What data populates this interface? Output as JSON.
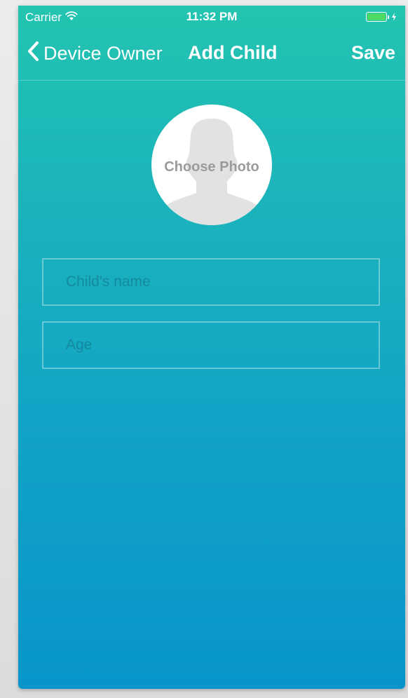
{
  "status_bar": {
    "carrier": "Carrier",
    "wifi_icon": "wifi-icon",
    "time": "11:32 PM",
    "battery_icon": "battery-charging-icon",
    "battery_color": "#4cd964"
  },
  "nav": {
    "back_label": "Device Owner",
    "back_icon": "chevron-left-icon",
    "title": "Add Child",
    "save_label": "Save"
  },
  "photo": {
    "label": "Choose Photo",
    "placeholder_icon": "person-silhouette-icon"
  },
  "form": {
    "name_placeholder": "Child's name",
    "name_value": "",
    "age_placeholder": "Age",
    "age_value": ""
  },
  "colors": {
    "gradient_top": "#23c4b0",
    "gradient_bottom": "#0896ca",
    "text": "#ffffff"
  }
}
